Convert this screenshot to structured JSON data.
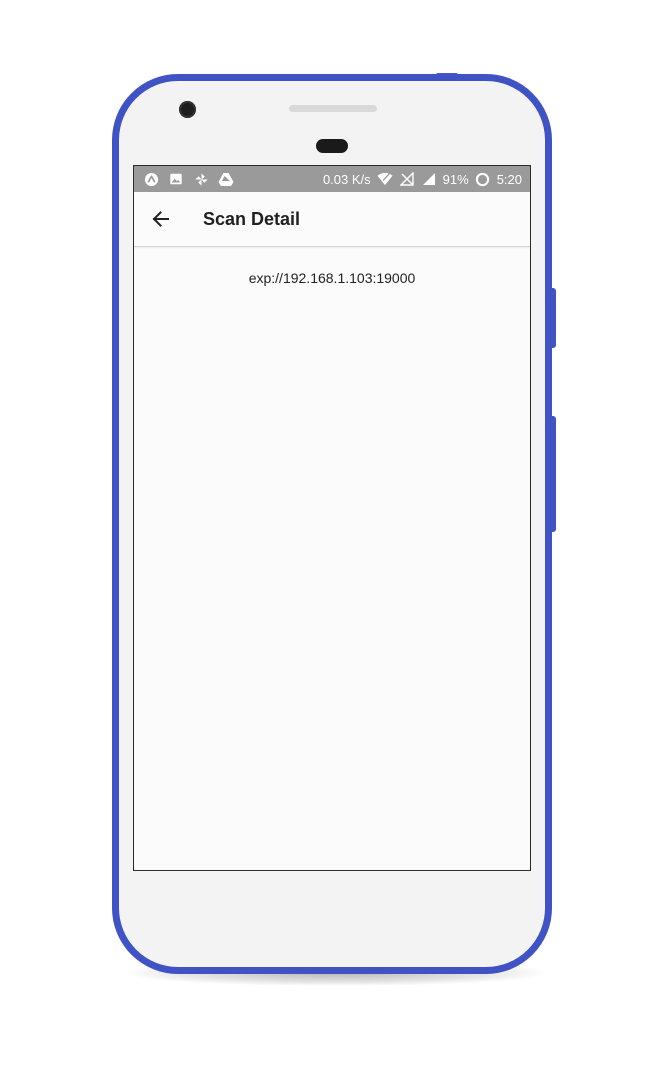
{
  "status_bar": {
    "left_icons": [
      "expo-icon",
      "image-icon",
      "pinwheel-icon",
      "drive-icon"
    ],
    "speed": "0.03 K/s",
    "battery": "91%",
    "time": "5:20",
    "right_icons": [
      "wifi-icon",
      "no-sim-signal-icon",
      "cell-signal-icon",
      "sync-icon"
    ]
  },
  "app_bar": {
    "back_icon": "arrow-back-icon",
    "title": "Scan Detail"
  },
  "content": {
    "scanned_value": "exp://192.168.1.103:19000"
  },
  "colors": {
    "phone_frame": "#3f53c4",
    "status_bar": "#9a9a9a",
    "screen_background": "#fbfbfb"
  }
}
